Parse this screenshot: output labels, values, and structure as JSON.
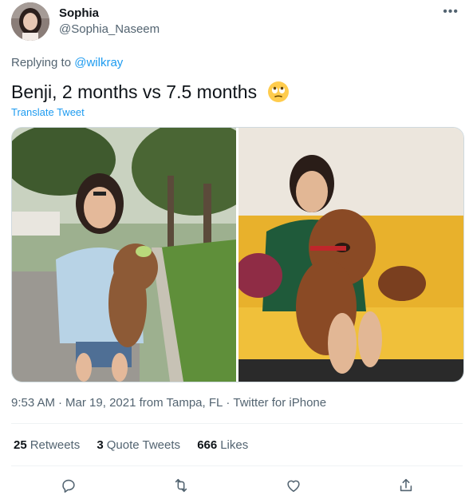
{
  "user": {
    "name": "Sophia",
    "handle": "@Sophia_Naseem"
  },
  "more_label": "•••",
  "reply": {
    "prefix": "Replying to ",
    "mention": "@wilkray"
  },
  "tweet": {
    "text": "Benji, 2 months vs 7.5 months",
    "emoji": "face-with-rolling-eyes-emoji",
    "translate_label": "Translate Tweet"
  },
  "media": {
    "photos": [
      {
        "subject": "girl-holding-puppy-on-sidewalk"
      },
      {
        "subject": "girl-with-grown-dog-on-yellow-couch"
      }
    ]
  },
  "meta": {
    "time": "9:53 AM",
    "date": "Mar 19, 2021",
    "location": "from Tampa, FL",
    "source": "Twitter for iPhone"
  },
  "stats": {
    "retweets_count": "25",
    "retweets_label": "Retweets",
    "quotes_count": "3",
    "quotes_label": "Quote Tweets",
    "likes_count": "666",
    "likes_label": "Likes"
  },
  "actions": [
    "reply-icon",
    "retweet-icon",
    "like-icon",
    "share-icon"
  ],
  "colors": {
    "link": "#1d9bf0",
    "secondary_text": "#536471",
    "primary_text": "#0f1419",
    "divider": "#eff3f4"
  }
}
